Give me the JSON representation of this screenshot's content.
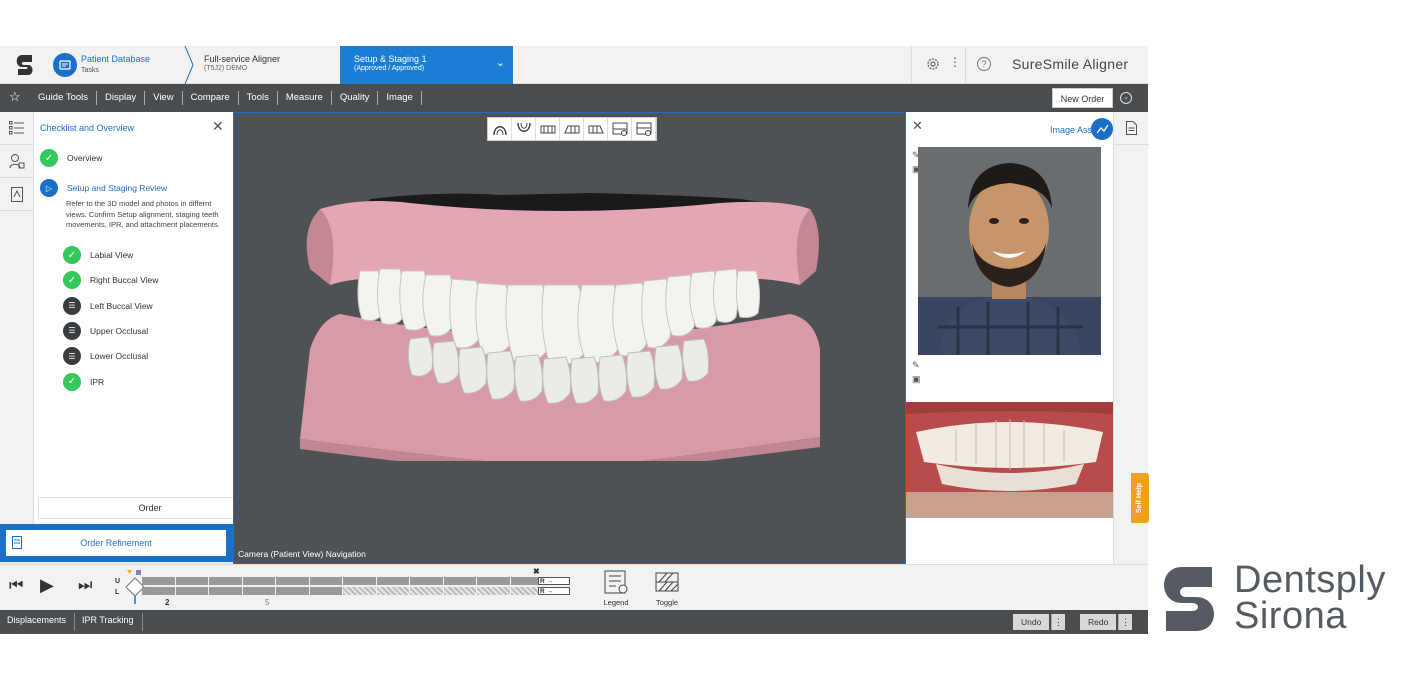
{
  "header": {
    "crumb1_title": "Patient Database",
    "crumb1_sub": "Tasks",
    "crumb2_title": "Full-service Aligner",
    "crumb2_sub": "(T5J2) DEMO",
    "crumb3_title": "Setup & Staging 1",
    "crumb3_sub": "(Approved / Approved)",
    "product": "SureSmile Aligner"
  },
  "menubar": {
    "items": [
      "Guide Tools",
      "Display",
      "View",
      "Compare",
      "Tools",
      "Measure",
      "Quality",
      "Image"
    ],
    "new_order": "New Order"
  },
  "checklist": {
    "title": "Checklist and Overview",
    "overview": "Overview",
    "review_title": "Setup and Staging Review",
    "review_desc": "Refer to the 3D model and photos in differnt views. Confirm Setup alignment, staging teeth movements, IPR, and attachment placements.",
    "steps": [
      {
        "label": "Labial View",
        "status": "done"
      },
      {
        "label": "Right Buccal View",
        "status": "done"
      },
      {
        "label": "Left Buccal View",
        "status": "pending"
      },
      {
        "label": "Upper Occlusal",
        "status": "pending"
      },
      {
        "label": "Lower Occlusal",
        "status": "pending"
      },
      {
        "label": "IPR",
        "status": "done"
      }
    ],
    "order": "Order",
    "order_refinement": "Order Refinement"
  },
  "viewport": {
    "caption": "Camera (Patient View) Navigation"
  },
  "image_assets": {
    "title": "Image Assets"
  },
  "self_help": "Self Help",
  "playback": {
    "upper": "U",
    "lower": "L",
    "stage_current": "2",
    "stage_mark": "5",
    "arrow_r1": "R →",
    "arrow_r2": "R →",
    "legend": "Legend",
    "toggle": "Toggle"
  },
  "statusbar": {
    "displacements": "Displacements",
    "ipr_tracking": "IPR Tracking",
    "undo": "Undo",
    "redo": "Redo",
    "dots": "⋮"
  },
  "brand": {
    "line1": "Dentsply",
    "line2": "Sirona"
  },
  "colors": {
    "accent": "#1b6fc4",
    "viewport_bg": "#4f5255",
    "check_done": "#34c759",
    "self_help": "#f0a020"
  }
}
